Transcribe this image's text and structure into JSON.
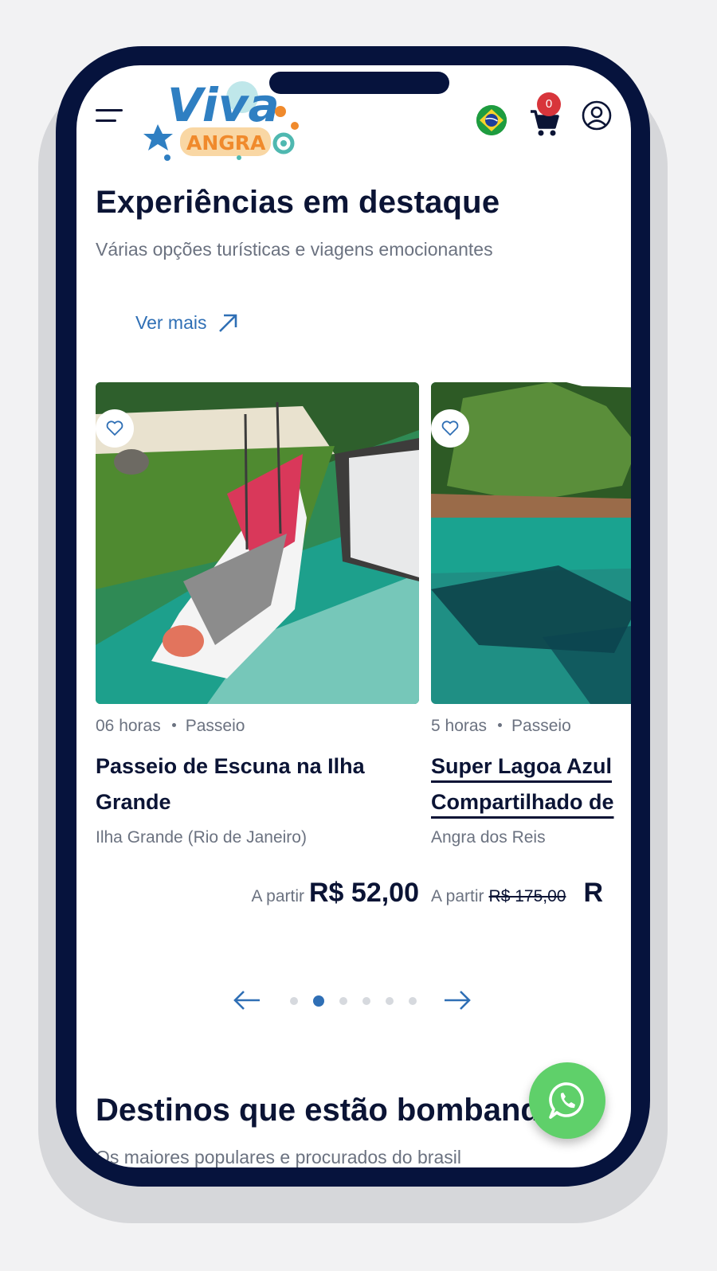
{
  "header": {
    "logo_text_top": "Viva",
    "logo_text_bottom": "ANGRA",
    "cart_count": "0",
    "icons": [
      "menu-icon",
      "brazil-flag-icon",
      "cart-icon",
      "user-icon"
    ]
  },
  "section": {
    "title": "Experiências em destaque",
    "subtitle": "Várias opções turísticas e viagens emocionantes",
    "see_more": "Ver mais"
  },
  "cards": [
    {
      "duration": "06 horas",
      "category": "Passeio",
      "title": "Passeio de Escuna na Ilha Grande",
      "location": "Ilha Grande (Rio de Janeiro)",
      "from_label": "A partir",
      "price": "R$ 52,00"
    },
    {
      "duration": "5 horas",
      "category": "Passeio",
      "title_line1": "Super Lagoa Azul",
      "title_line2": "Compartilhado de",
      "location": "Angra dos Reis",
      "from_label": "A partir",
      "old_price": "R$ 175,00",
      "price": "R"
    }
  ],
  "pager": {
    "dots": 6,
    "active_index": 1
  },
  "destinations": {
    "title": "Destinos que estão bombando",
    "subtitle": "Os maiores populares e procurados do brasil"
  },
  "colors": {
    "navy": "#0b1435",
    "accent_blue": "#2f6fb5",
    "badge_red": "#d8353b",
    "whatsapp_green": "#5fd06a"
  }
}
